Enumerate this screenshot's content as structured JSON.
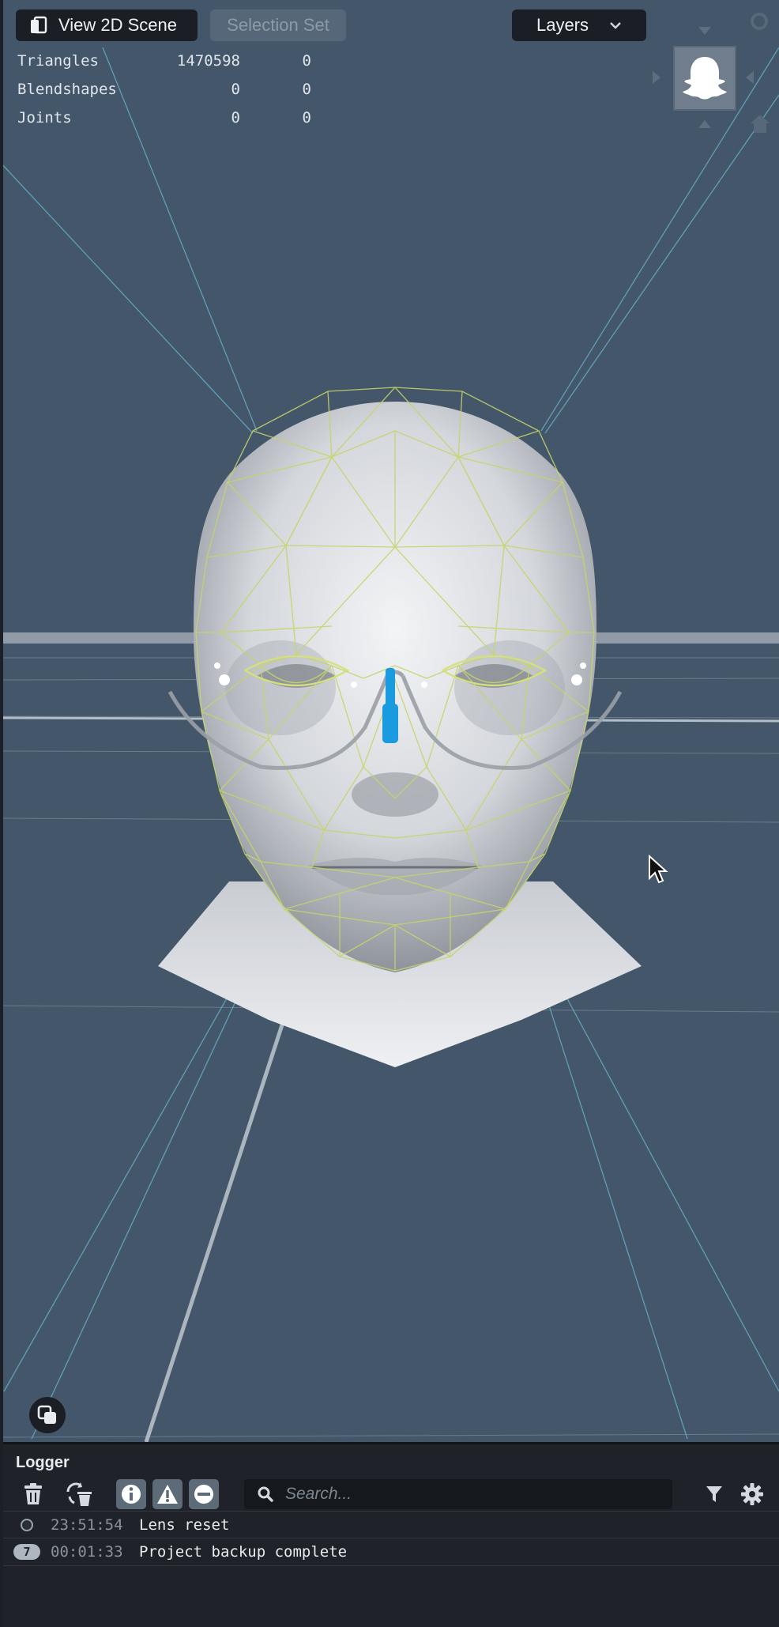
{
  "toolbar": {
    "view_2d_label": "View 2D Scene",
    "selection_set_label": "Selection Set",
    "layers_label": "Layers"
  },
  "stats": [
    {
      "label": "Triangles",
      "value1": "1470598",
      "value2": "0"
    },
    {
      "label": "Blendshapes",
      "value1": "0",
      "value2": "0"
    },
    {
      "label": "Joints",
      "value1": "0",
      "value2": "0"
    }
  ],
  "logger": {
    "title": "Logger",
    "search_placeholder": "Search...",
    "entries": [
      {
        "count": "",
        "time": "23:51:54",
        "message": "Lens reset"
      },
      {
        "count": "7",
        "time": "00:01:33",
        "message": "Project backup complete"
      }
    ]
  },
  "icons": {
    "view2d": "layers-icon",
    "layers_dropdown": "chevron-down-icon",
    "lens_preview": "ghost-icon",
    "overlay": "overlay-toggle-icon",
    "trash": "trash-icon",
    "clear_reload": "clear-reload-icon",
    "info": "info-icon",
    "warning": "warning-icon",
    "error": "error-icon",
    "search": "search-icon",
    "filter": "filter-icon",
    "settings": "gear-icon"
  },
  "colors": {
    "viewport_bg": "#43566a",
    "mesh_wire": "#c6d46a",
    "anchor_blue": "#1a9be0",
    "panel_bg": "#1f2329"
  }
}
